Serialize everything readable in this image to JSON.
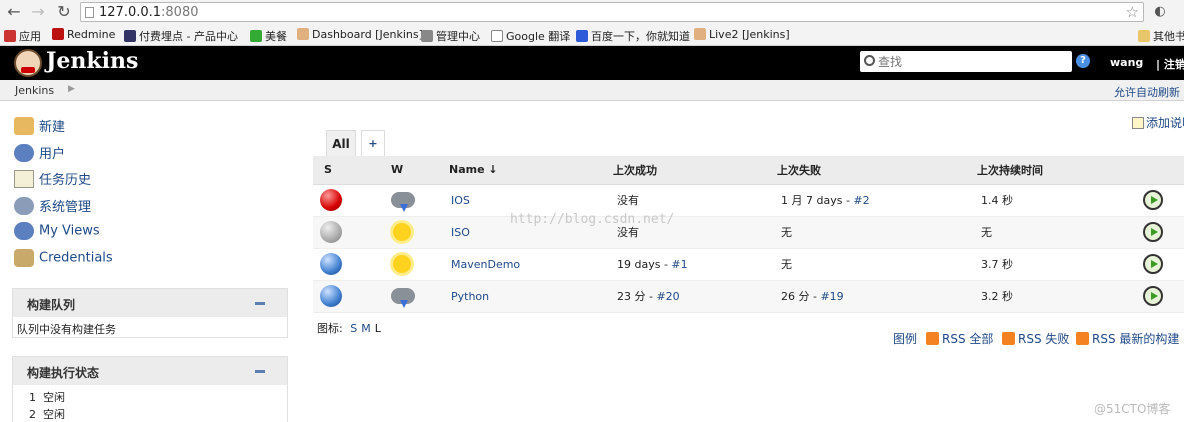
{
  "browser": {
    "url_host": "127.0.0.1",
    "url_port": ":8080",
    "bookmarks": [
      "应用",
      "Redmine",
      "付费埋点 - 产品中心",
      "美餐",
      "Dashboard [Jenkins]",
      "管理中心",
      "Google 翻译",
      "百度一下，你就知道",
      "Live2 [Jenkins]"
    ],
    "other_bookmarks": "其他书"
  },
  "header": {
    "title": "Jenkins",
    "search_placeholder": "查找",
    "help": "?",
    "user": "wang",
    "logout": "| 注销"
  },
  "breadcrumb": {
    "root": "Jenkins",
    "autorefresh": "允许自动刷新"
  },
  "sidebar": {
    "tasks": [
      "新建",
      "用户",
      "任务历史",
      "系统管理",
      "My Views",
      "Credentials"
    ],
    "queue": {
      "title": "构建队列",
      "empty": "队列中没有构建任务"
    },
    "executors": {
      "title": "构建执行状态",
      "rows": [
        {
          "n": "1",
          "s": "空闲"
        },
        {
          "n": "2",
          "s": "空闲"
        }
      ]
    }
  },
  "main": {
    "tab_all": "All",
    "tab_add": "+",
    "add_description": "添加说明",
    "columns": [
      "S",
      "W",
      "Name ↓",
      "上次成功",
      "上次失败",
      "上次持续时间"
    ],
    "rows": [
      {
        "status": "red",
        "weather": "storm",
        "name": "IOS",
        "last_success": "没有",
        "last_fail": "1 月 7 days - ",
        "last_fail_link": "#2",
        "duration": "1.4 秒"
      },
      {
        "status": "grey",
        "weather": "sun",
        "name": "ISO",
        "last_success": "没有",
        "last_fail": "无",
        "last_fail_link": "",
        "duration": "无"
      },
      {
        "status": "blue",
        "weather": "sun",
        "name": "MavenDemo",
        "last_success": "19 days - ",
        "last_success_link": "#1",
        "last_fail": "无",
        "last_fail_link": "",
        "duration": "3.7 秒"
      },
      {
        "status": "blue",
        "weather": "storm",
        "name": "Python",
        "last_success": "23 分 - ",
        "last_success_link": "#20",
        "last_fail": "26 分 - ",
        "last_fail_link": "#19",
        "duration": "3.2 秒"
      }
    ],
    "icon_label": "图标:",
    "icon_sizes": [
      "S",
      "M",
      "L"
    ],
    "legend": "图例",
    "rss_all": "RSS 全部",
    "rss_fail": "RSS 失败",
    "rss_latest": "RSS 最新的构建"
  },
  "watermarks": {
    "center": "http://blog.csdn.net/",
    "corner": "@51CTO博客"
  }
}
